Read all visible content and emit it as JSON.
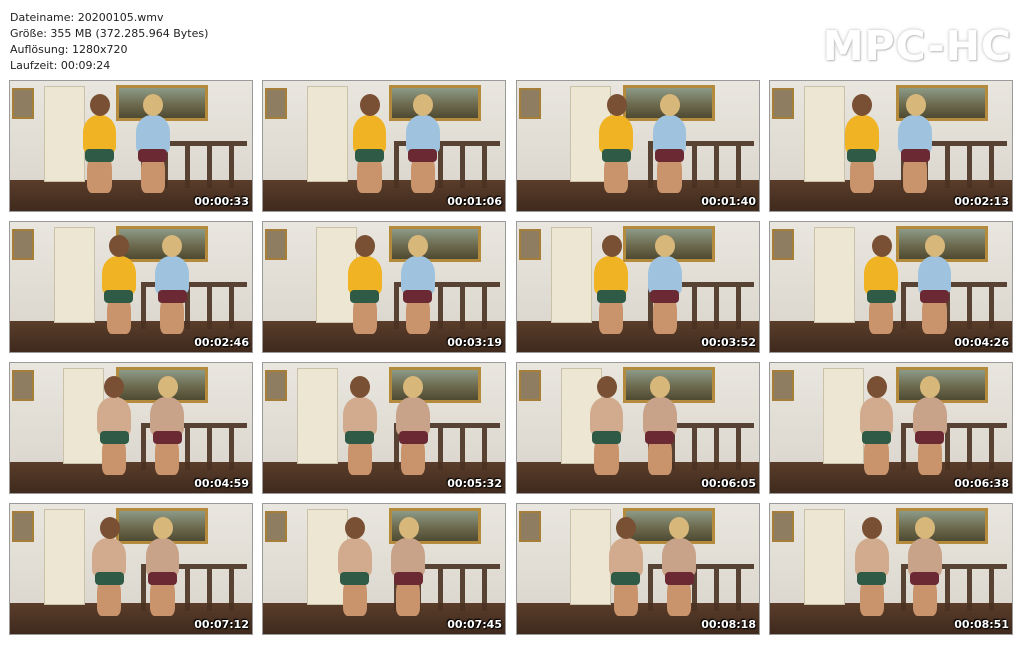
{
  "info": {
    "filename": "Dateiname: 20200105.wmv",
    "size": "Größe: 355 MB (372.285.964 Bytes)",
    "resolution": "Auflösung: 1280x720",
    "duration": "Laufzeit: 00:09:24"
  },
  "logo": "MPC-HC",
  "thumbnails": [
    {
      "time": "00:00:33"
    },
    {
      "time": "00:01:06"
    },
    {
      "time": "00:01:40"
    },
    {
      "time": "00:02:13"
    },
    {
      "time": "00:02:46"
    },
    {
      "time": "00:03:19"
    },
    {
      "time": "00:03:52"
    },
    {
      "time": "00:04:26"
    },
    {
      "time": "00:04:59"
    },
    {
      "time": "00:05:32"
    },
    {
      "time": "00:06:05"
    },
    {
      "time": "00:06:38"
    },
    {
      "time": "00:07:12"
    },
    {
      "time": "00:07:45"
    },
    {
      "time": "00:08:18"
    },
    {
      "time": "00:08:51"
    }
  ]
}
